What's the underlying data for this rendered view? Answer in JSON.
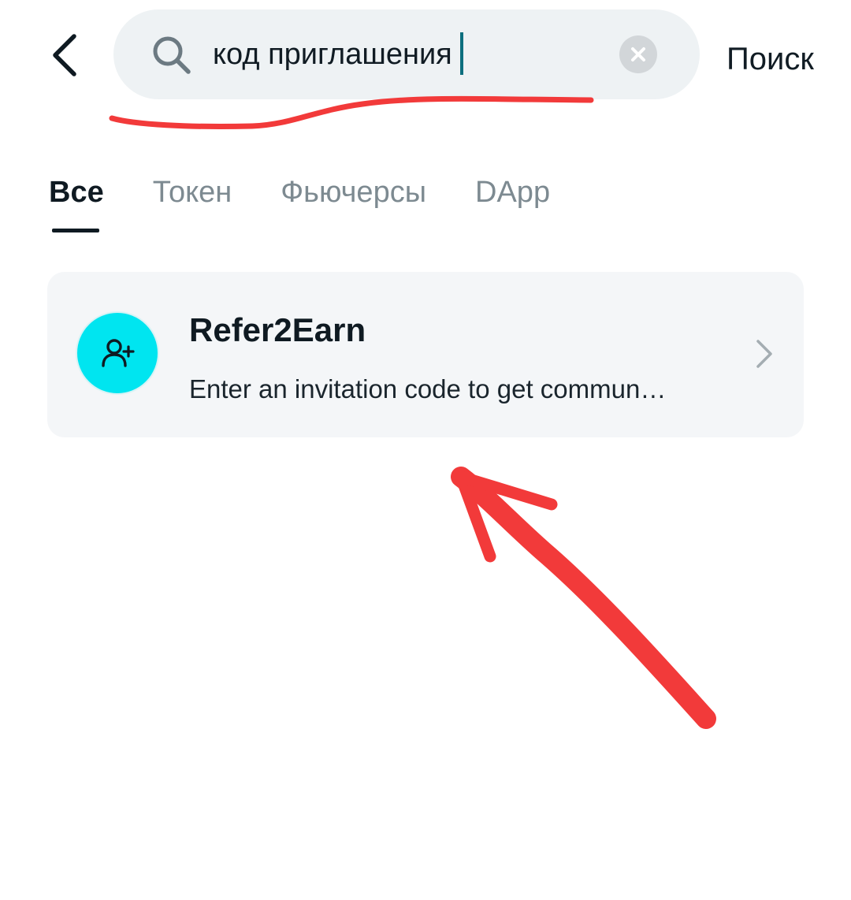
{
  "header": {
    "back_icon": "chevron-left-icon",
    "search": {
      "icon": "search-icon",
      "value": "код приглашения",
      "clear_icon": "close-icon"
    },
    "action_label": "Поиск"
  },
  "tabs": [
    {
      "label": "Все",
      "active": true
    },
    {
      "label": "Токен",
      "active": false
    },
    {
      "label": "Фьючерсы",
      "active": false
    },
    {
      "label": "DApp",
      "active": false
    }
  ],
  "results": [
    {
      "icon": "add-user-icon",
      "title": "Refer2Earn",
      "description": "Enter an invitation code to get commun…",
      "chevron_icon": "chevron-right-icon"
    }
  ],
  "colors": {
    "accent": "#00e5f0",
    "caret": "#0d6f7e",
    "annotation": "#f23a3a"
  }
}
